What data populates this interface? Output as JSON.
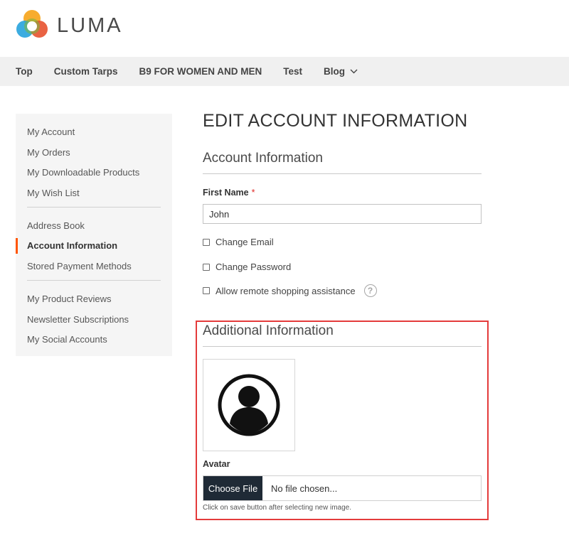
{
  "brand": {
    "name": "LUMA"
  },
  "nav": {
    "items": [
      {
        "label": "Top"
      },
      {
        "label": "Custom Tarps"
      },
      {
        "label": "B9 FOR WOMEN AND MEN"
      },
      {
        "label": "Test"
      },
      {
        "label": "Blog",
        "icon": "chevron-down-icon"
      }
    ]
  },
  "sidebar": {
    "groups": [
      [
        "My Account",
        "My Orders",
        "My Downloadable Products",
        "My Wish List"
      ],
      [
        "Address Book",
        "Account Information",
        "Stored Payment Methods"
      ],
      [
        "My Product Reviews",
        "Newsletter Subscriptions",
        "My Social Accounts"
      ]
    ],
    "active": "Account Information"
  },
  "page": {
    "title": "EDIT ACCOUNT INFORMATION"
  },
  "account_info": {
    "section_title": "Account Information",
    "first_name_label": "First Name",
    "required_marker": "*",
    "first_name_value": "John",
    "checkboxes": [
      "Change Email",
      "Change Password",
      "Allow remote shopping assistance"
    ],
    "help_icon": "?"
  },
  "additional_info": {
    "section_title": "Additional Information",
    "avatar_label": "Avatar",
    "avatar_icon": "user-avatar-icon",
    "choose_file_label": "Choose File",
    "file_status": "No file chosen...",
    "hint": "Click on save button after selecting new image."
  },
  "colors": {
    "accent": "#ff5501",
    "highlight_border": "#e43b3b",
    "button_bg": "#1f2a36",
    "required": "#e02b27"
  }
}
